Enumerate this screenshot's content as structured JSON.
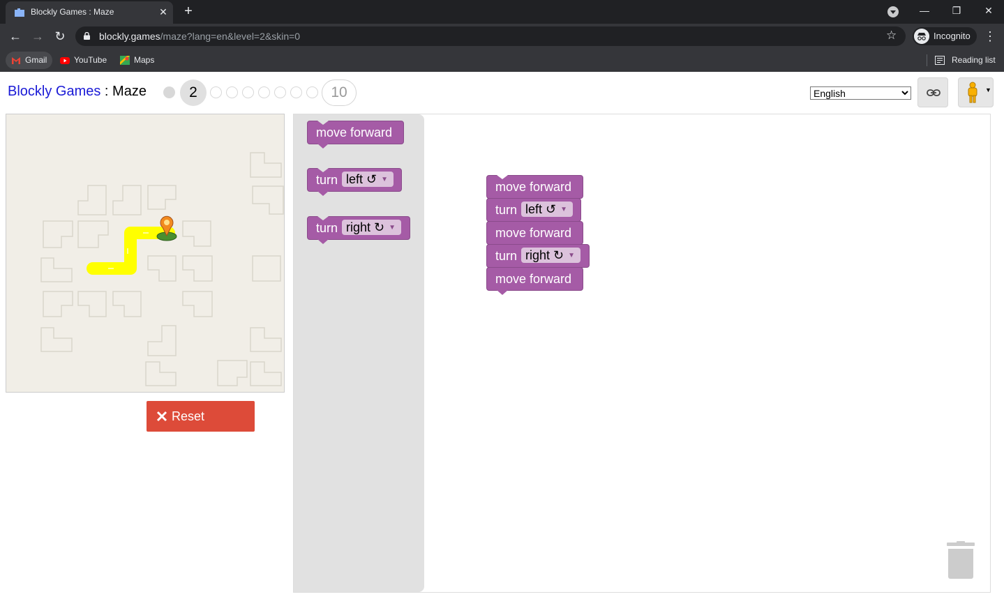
{
  "browser": {
    "tab_title": "Blockly Games : Maze",
    "url_host": "blockly.games",
    "url_path": "/maze?lang=en&level=2&skin=0",
    "profile_label": "Incognito",
    "bookmarks": [
      {
        "label": "Gmail"
      },
      {
        "label": "YouTube"
      },
      {
        "label": "Maps"
      }
    ],
    "reading_list": "Reading list"
  },
  "header": {
    "site_name": "Blockly Games",
    "separator": " : ",
    "game_name": "Maze",
    "current_level": "2",
    "last_level": "10",
    "language": "English",
    "language_options": [
      "English"
    ]
  },
  "controls": {
    "reset_label": "Reset"
  },
  "flyout": {
    "blocks": [
      {
        "text": "move forward"
      },
      {
        "text": "turn",
        "dropdown": "left ↺"
      },
      {
        "text": "turn",
        "dropdown": "right ↻"
      }
    ]
  },
  "program": {
    "blocks": [
      {
        "text": "move forward"
      },
      {
        "text": "turn",
        "dropdown": "left ↺"
      },
      {
        "text": "move forward"
      },
      {
        "text": "turn",
        "dropdown": "right ↻"
      },
      {
        "text": "move forward"
      }
    ]
  },
  "colors": {
    "block": "#a55ba6",
    "reset": "#dd4b39",
    "path": "#ffff00",
    "maze_bg": "#f1eee7",
    "link": "#1a1ad6"
  }
}
